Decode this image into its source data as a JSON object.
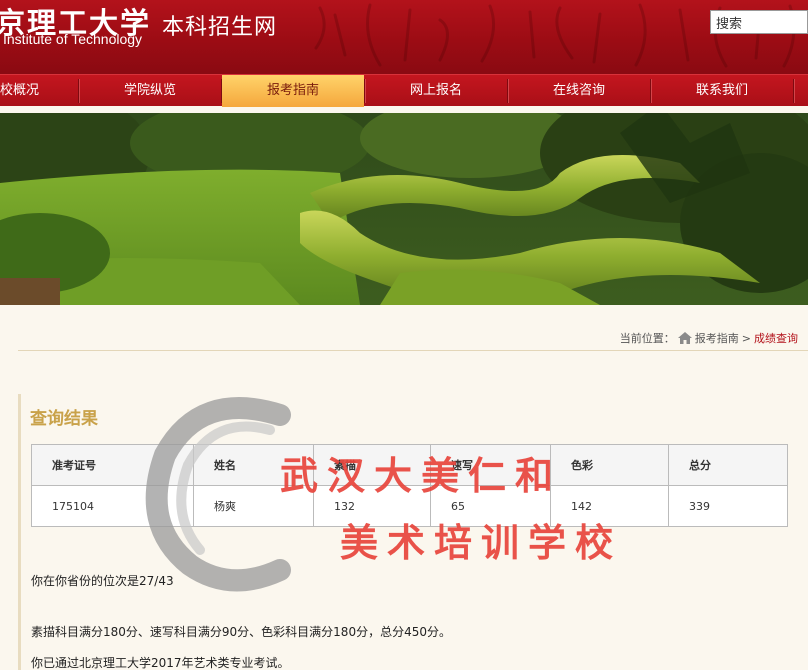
{
  "header": {
    "logo_cn": "京理工大学",
    "logo_en": "Institute of Technology",
    "site_title": "本科招生网",
    "search_placeholder": "搜索"
  },
  "nav": {
    "items": [
      {
        "label": "校概况"
      },
      {
        "label": "学院纵览"
      },
      {
        "label": "报考指南",
        "active": true
      },
      {
        "label": "网上报名"
      },
      {
        "label": "在线咨询"
      },
      {
        "label": "联系我们"
      }
    ]
  },
  "breadcrumb": {
    "prefix": "当前位置：",
    "parent": "报考指南",
    "separator": ">",
    "current": "成绩查询"
  },
  "results": {
    "title": "查询结果",
    "headers": [
      "准考证号",
      "姓名",
      "素描",
      "速写",
      "色彩",
      "总分"
    ],
    "rows": [
      [
        "175104",
        "杨爽",
        "132",
        "65",
        "142",
        "339"
      ]
    ]
  },
  "info": {
    "rank": "你在你省份的位次是27/43",
    "full_marks": "素描科目满分180分、速写科目满分90分、色彩科目满分180分，总分450分。",
    "passed": "你已通过北京理工大学2017年艺术类专业考试。"
  },
  "watermark": {
    "line1": "武汉大美仁和",
    "line2": "美术培训学校"
  },
  "colors": {
    "header_red": "#b3121b",
    "nav_active": "#f5a73c",
    "title_gold": "#c9a24a",
    "watermark_red": "#e8453c"
  }
}
